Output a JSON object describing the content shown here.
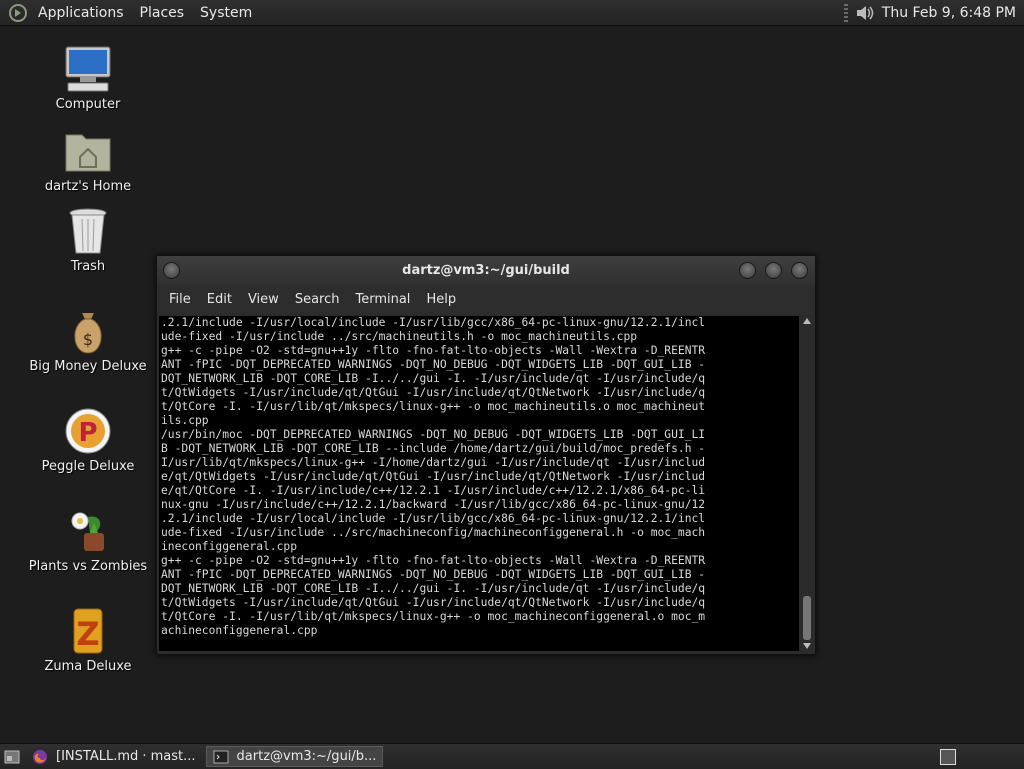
{
  "top_panel": {
    "menus": [
      "Applications",
      "Places",
      "System"
    ],
    "clock": "Thu Feb  9,  6:48 PM"
  },
  "desktop_icons": [
    {
      "label": "Computer"
    },
    {
      "label": "dartz's Home"
    },
    {
      "label": "Trash"
    },
    {
      "label": "Big Money Deluxe"
    },
    {
      "label": "Peggle Deluxe"
    },
    {
      "label": "Plants vs Zombies"
    },
    {
      "label": "Zuma Deluxe"
    }
  ],
  "terminal": {
    "title": "dartz@vm3:~/gui/build",
    "menu": [
      "File",
      "Edit",
      "View",
      "Search",
      "Terminal",
      "Help"
    ],
    "output": ".2.1/include -I/usr/local/include -I/usr/lib/gcc/x86_64-pc-linux-gnu/12.2.1/incl\nude-fixed -I/usr/include ../src/machineutils.h -o moc_machineutils.cpp\ng++ -c -pipe -O2 -std=gnu++1y -flto -fno-fat-lto-objects -Wall -Wextra -D_REENTR\nANT -fPIC -DQT_DEPRECATED_WARNINGS -DQT_NO_DEBUG -DQT_WIDGETS_LIB -DQT_GUI_LIB -\nDQT_NETWORK_LIB -DQT_CORE_LIB -I../../gui -I. -I/usr/include/qt -I/usr/include/q\nt/QtWidgets -I/usr/include/qt/QtGui -I/usr/include/qt/QtNetwork -I/usr/include/q\nt/QtCore -I. -I/usr/lib/qt/mkspecs/linux-g++ -o moc_machineutils.o moc_machineut\nils.cpp\n/usr/bin/moc -DQT_DEPRECATED_WARNINGS -DQT_NO_DEBUG -DQT_WIDGETS_LIB -DQT_GUI_LI\nB -DQT_NETWORK_LIB -DQT_CORE_LIB --include /home/dartz/gui/build/moc_predefs.h -\nI/usr/lib/qt/mkspecs/linux-g++ -I/home/dartz/gui -I/usr/include/qt -I/usr/includ\ne/qt/QtWidgets -I/usr/include/qt/QtGui -I/usr/include/qt/QtNetwork -I/usr/includ\ne/qt/QtCore -I. -I/usr/include/c++/12.2.1 -I/usr/include/c++/12.2.1/x86_64-pc-li\nnux-gnu -I/usr/include/c++/12.2.1/backward -I/usr/lib/gcc/x86_64-pc-linux-gnu/12\n.2.1/include -I/usr/local/include -I/usr/lib/gcc/x86_64-pc-linux-gnu/12.2.1/incl\nude-fixed -I/usr/include ../src/machineconfig/machineconfiggeneral.h -o moc_mach\nineconfiggeneral.cpp\ng++ -c -pipe -O2 -std=gnu++1y -flto -fno-fat-lto-objects -Wall -Wextra -D_REENTR\nANT -fPIC -DQT_DEPRECATED_WARNINGS -DQT_NO_DEBUG -DQT_WIDGETS_LIB -DQT_GUI_LIB -\nDQT_NETWORK_LIB -DQT_CORE_LIB -I../../gui -I. -I/usr/include/qt -I/usr/include/q\nt/QtWidgets -I/usr/include/qt/QtGui -I/usr/include/qt/QtNetwork -I/usr/include/q\nt/QtCore -I. -I/usr/lib/qt/mkspecs/linux-g++ -o moc_machineconfiggeneral.o moc_m\nachineconfiggeneral.cpp"
  },
  "taskbar": {
    "tasks": [
      {
        "label": "[INSTALL.md · mast...",
        "icon": "firefox-icon"
      },
      {
        "label": "dartz@vm3:~/gui/b...",
        "icon": "terminal-icon"
      }
    ]
  }
}
